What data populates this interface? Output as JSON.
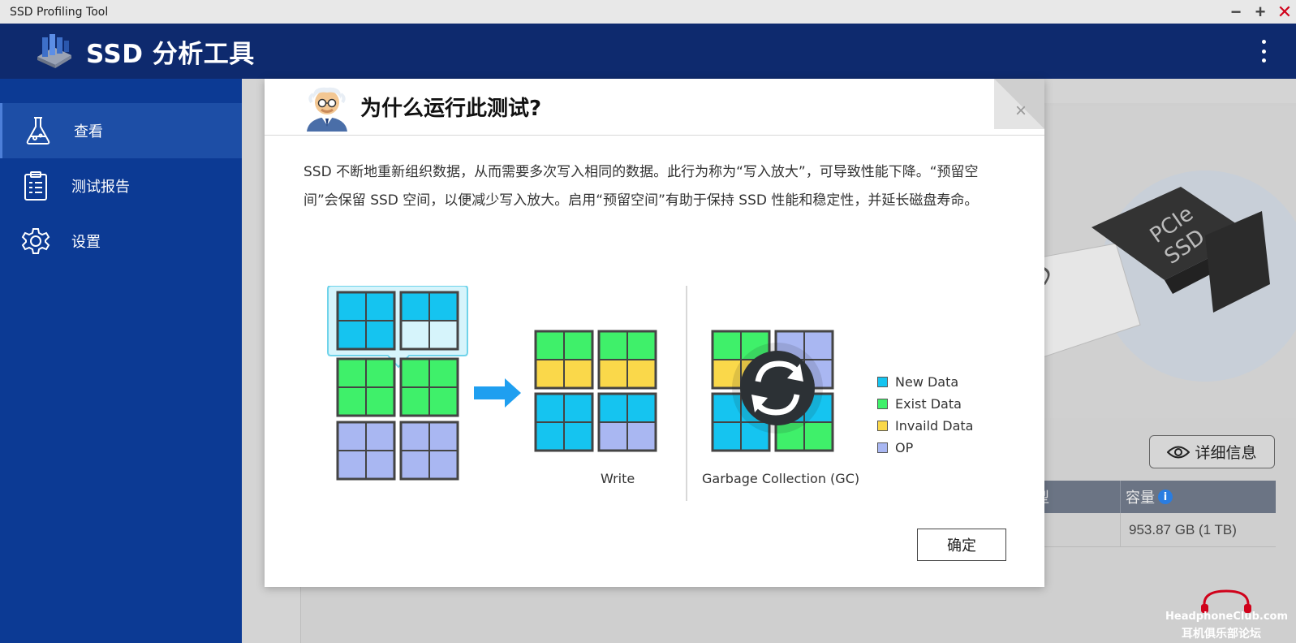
{
  "window": {
    "title": "SSD Profiling Tool",
    "controls": {
      "minimize": "−",
      "maximize": "+",
      "close": "✕"
    }
  },
  "header": {
    "app_title": "SSD 分析工具",
    "menu_icon": "kebab-menu-icon"
  },
  "sidebar": {
    "items": [
      {
        "label": "查看",
        "icon": "flask-icon",
        "active": true
      },
      {
        "label": "测试报告",
        "icon": "clipboard-icon",
        "active": false
      },
      {
        "label": "设置",
        "icon": "gear-icon",
        "active": false
      }
    ]
  },
  "main": {
    "hero_text": {
      "line1": "PCIe",
      "line2": "SSD",
      "partial": "SD"
    },
    "detail_button": "详细信息",
    "table": {
      "headers": {
        "type_partial": "型",
        "capacity": "容量"
      },
      "row": {
        "capacity": "953.87 GB (1 TB)"
      }
    }
  },
  "dialog": {
    "title": "为什么运行此测试?",
    "close": "×",
    "body": "SSD 不断地重新组织数据，从而需要多次写入相同的数据。此行为称为“写入放大”，可导致性能下降。“预留空间”会保留 SSD 空间，以便减少写入放大。启用“预留空间”有助于保持 SSD 性能和稳定性，并延长磁盘寿命。",
    "illustration": {
      "write_label": "Write",
      "gc_label": "Garbage Collection (GC)",
      "legend": [
        {
          "label": "New Data",
          "color": "#15c4f0"
        },
        {
          "label": "Exist Data",
          "color": "#3ff06a"
        },
        {
          "label": "Invaild Data",
          "color": "#fad84a"
        },
        {
          "label": "OP",
          "color": "#a9b7f2"
        }
      ]
    },
    "ok_button": "确定"
  },
  "watermark": {
    "line1": "HeadphoneClub.com",
    "line2": "耳机俱乐部论坛"
  }
}
